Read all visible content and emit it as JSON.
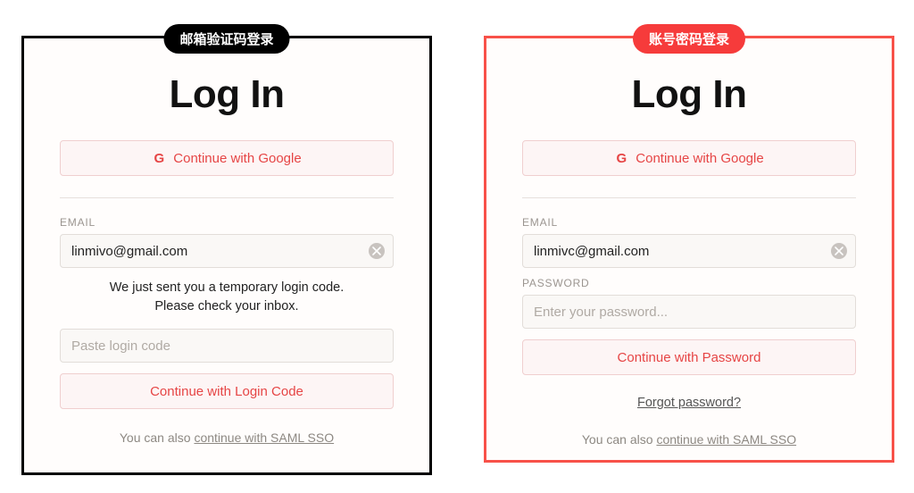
{
  "left": {
    "badge": "邮箱验证码登录",
    "title": "Log In",
    "google_label": "Continue with Google",
    "email_label": "EMAIL",
    "email_value": "linmivo@gmail.com",
    "sent_msg_line1": "We just sent you a temporary login code.",
    "sent_msg_line2": "Please check your inbox.",
    "code_placeholder": "Paste login code",
    "continue_code_label": "Continue with Login Code",
    "saml_prefix": "You can also ",
    "saml_link": "continue with SAML SSO"
  },
  "right": {
    "badge": "账号密码登录",
    "title": "Log In",
    "google_label": "Continue with Google",
    "email_label": "EMAIL",
    "email_value": "linmivc@gmail.com",
    "password_label": "PASSWORD",
    "password_placeholder": "Enter your password...",
    "continue_pwd_label": "Continue with Password",
    "forgot_label": "Forgot password?",
    "saml_prefix": "You can also ",
    "saml_link": "continue with SAML SSO"
  }
}
